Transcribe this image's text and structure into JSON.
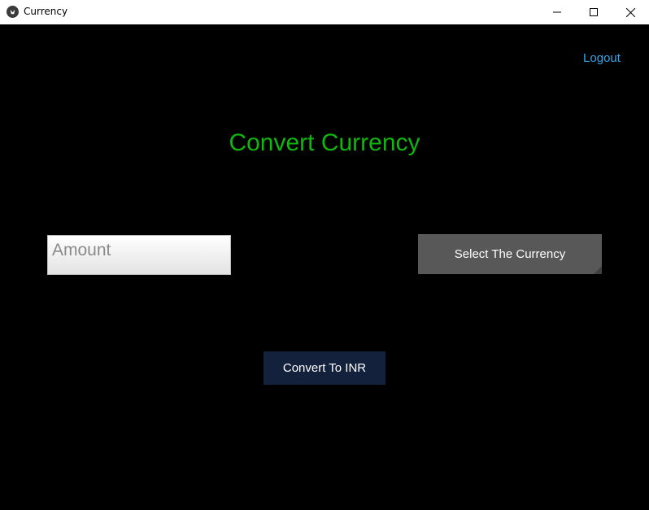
{
  "window": {
    "title": "Currency",
    "icon": "kivy-app-icon",
    "controls": [
      "minimize-icon",
      "maximize-icon",
      "close-icon"
    ]
  },
  "header": {
    "logout_label": "Logout"
  },
  "main": {
    "heading": "Convert Currency",
    "amount_placeholder": "Amount",
    "amount_value": "",
    "select_currency_label": "Select The Currency",
    "convert_label": "Convert To INR"
  },
  "colors": {
    "background": "#000000",
    "heading": "#10b50f",
    "logout_link": "#33a6e8",
    "select_button": "#585858",
    "convert_button": "#14213d"
  }
}
